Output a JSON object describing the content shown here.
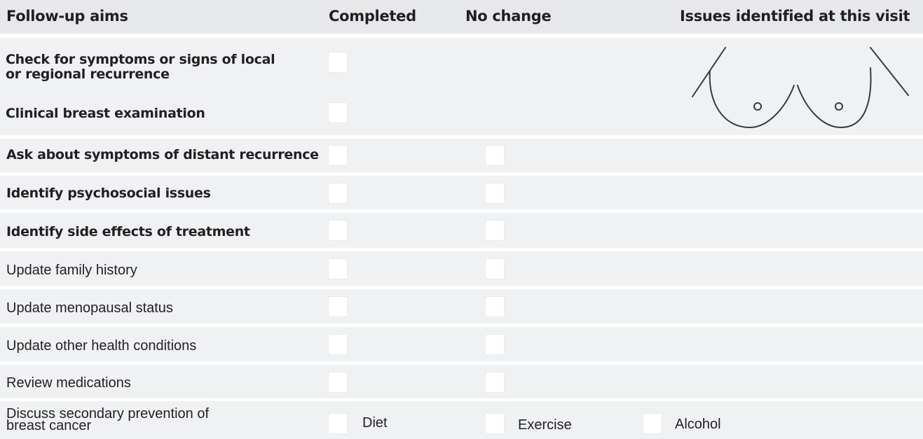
{
  "header": {
    "aims": "Follow-up aims",
    "completed": "Completed",
    "no_change": "No change",
    "issues": "Issues identified at this visit"
  },
  "rows": [
    {
      "label": "Check for symptoms or signs of local\nor regional recurrence",
      "completed": false
    },
    {
      "label": "Clinical breast examination",
      "completed": false
    },
    {
      "label": "Ask about symptoms of distant recurrence",
      "completed": false,
      "no_change": false
    },
    {
      "label": "Identify psychosocial issues",
      "completed": false,
      "no_change": false
    },
    {
      "label": "Identify side effects of treatment",
      "completed": false,
      "no_change": false
    },
    {
      "label": "Update family history",
      "completed": false,
      "no_change": false
    },
    {
      "label": "Update menopausal status",
      "completed": false,
      "no_change": false
    },
    {
      "label": "Update other health conditions",
      "completed": false,
      "no_change": false
    },
    {
      "label": "Review medications",
      "completed": false,
      "no_change": false
    },
    {
      "label": "Discuss secondary prevention of\nbreast cancer"
    }
  ],
  "prevention_options": [
    {
      "label": "Diet",
      "checked": false
    },
    {
      "label": "Exercise",
      "checked": false
    },
    {
      "label": "Alcohol",
      "checked": false
    }
  ],
  "diagram": {
    "name": "breast-diagram-icon",
    "stroke": "#3a3a3c"
  },
  "colors": {
    "header_bg": "#e7e8ea",
    "row_bg": "#f0f1f3",
    "text": "#231f20",
    "checkbox": "#ffffff"
  }
}
